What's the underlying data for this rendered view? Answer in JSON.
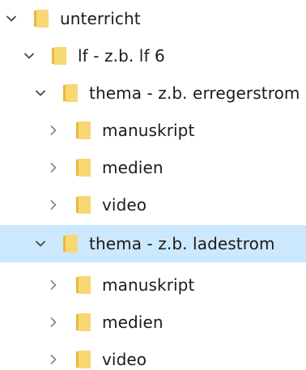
{
  "tree": {
    "colors": {
      "selected_background": "#cce8ff",
      "folder_front": "#f8d775",
      "folder_back": "#e8b83d",
      "chevron": "#444444",
      "text": "#1b1b1b"
    },
    "items": [
      {
        "label": "unterricht",
        "expanded": true,
        "selected": false,
        "chevron_icon": "chevron-down-icon",
        "icon": "folder-icon"
      },
      {
        "label": "lf - z.b. lf 6",
        "expanded": true,
        "selected": false,
        "chevron_icon": "chevron-down-icon",
        "icon": "folder-icon"
      },
      {
        "label": "thema - z.b. erregerstrom",
        "expanded": true,
        "selected": false,
        "chevron_icon": "chevron-down-icon",
        "icon": "folder-icon"
      },
      {
        "label": "manuskript",
        "expanded": false,
        "selected": false,
        "chevron_icon": "chevron-right-icon",
        "icon": "folder-icon"
      },
      {
        "label": "medien",
        "expanded": false,
        "selected": false,
        "chevron_icon": "chevron-right-icon",
        "icon": "folder-icon"
      },
      {
        "label": "video",
        "expanded": false,
        "selected": false,
        "chevron_icon": "chevron-right-icon",
        "icon": "folder-icon"
      },
      {
        "label": "thema - z.b. ladestrom",
        "expanded": true,
        "selected": true,
        "chevron_icon": "chevron-down-icon",
        "icon": "folder-icon"
      },
      {
        "label": "manuskript",
        "expanded": false,
        "selected": false,
        "chevron_icon": "chevron-right-icon",
        "icon": "folder-icon"
      },
      {
        "label": "medien",
        "expanded": false,
        "selected": false,
        "chevron_icon": "chevron-right-icon",
        "icon": "folder-icon"
      },
      {
        "label": "video",
        "expanded": false,
        "selected": false,
        "chevron_icon": "chevron-right-icon",
        "icon": "folder-icon"
      }
    ]
  }
}
